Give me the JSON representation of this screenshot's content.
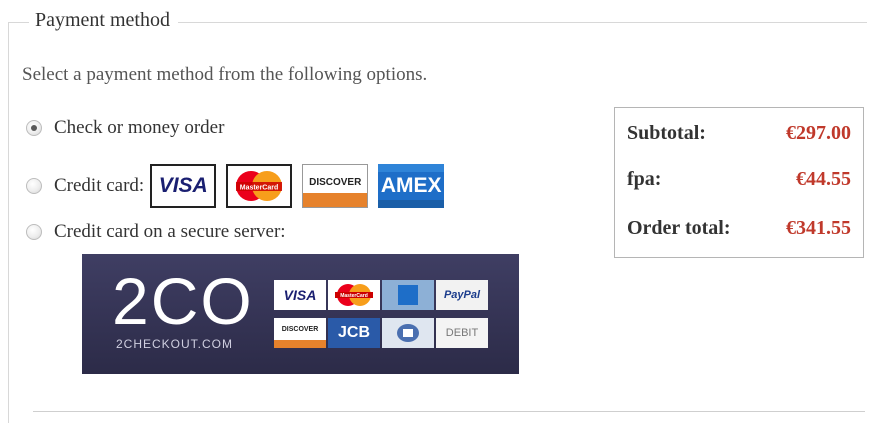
{
  "fieldset": {
    "legend": "Payment method"
  },
  "instruction": "Select a payment method from the following options.",
  "options": [
    {
      "label": "Check or money order",
      "checked": true
    },
    {
      "label": "Credit card:",
      "checked": false
    },
    {
      "label": "Credit card on a secure server:",
      "checked": false
    }
  ],
  "cards": {
    "visa": "VISA",
    "mastercard": "MasterCard",
    "discover": "DISCOVER",
    "amex": "AMEX"
  },
  "twoco": {
    "logo": "2CO",
    "domain": "2CHECKOUT.COM",
    "badges": {
      "visa": "VISA",
      "mastercard": "MasterCard",
      "paypal": "PayPal",
      "discover": "DISCOVER",
      "jcb": "JCB",
      "debit": "DEBIT"
    }
  },
  "summary": {
    "subtotal_label": "Subtotal:",
    "subtotal_value": "€297.00",
    "tax_label": "fpa:",
    "tax_value": "€44.55",
    "total_label": "Order total:",
    "total_value": "€341.55"
  },
  "colors": {
    "price": "#c0392b",
    "banner": "#3f3e63"
  }
}
